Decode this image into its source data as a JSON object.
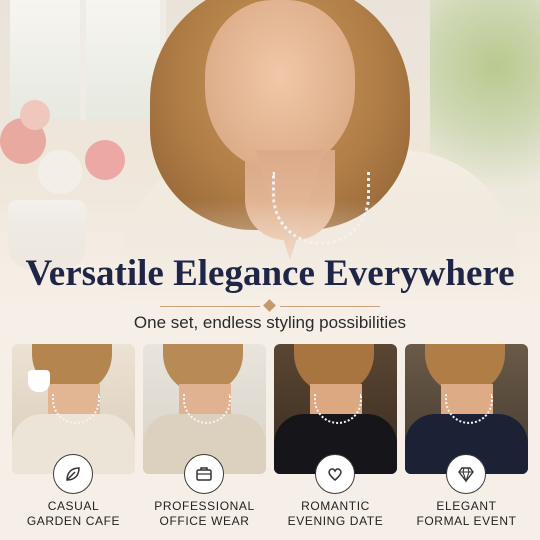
{
  "headline": "Versatile Elegance Everywhere",
  "subheadline": "One set, endless styling possibilities",
  "accent_color": "#c49a6c",
  "headline_color": "#1f2547",
  "cards": [
    {
      "line1": "CASUAL",
      "line2": "GARDEN CAFE",
      "icon": "leaf-icon"
    },
    {
      "line1": "PROFESSIONAL",
      "line2": "OFFICE WEAR",
      "icon": "briefcase-icon"
    },
    {
      "line1": "ROMANTIC",
      "line2": "EVENING DATE",
      "icon": "heart-icon"
    },
    {
      "line1": "ELEGANT",
      "line2": "FORMAL EVENT",
      "icon": "diamond-icon"
    }
  ]
}
